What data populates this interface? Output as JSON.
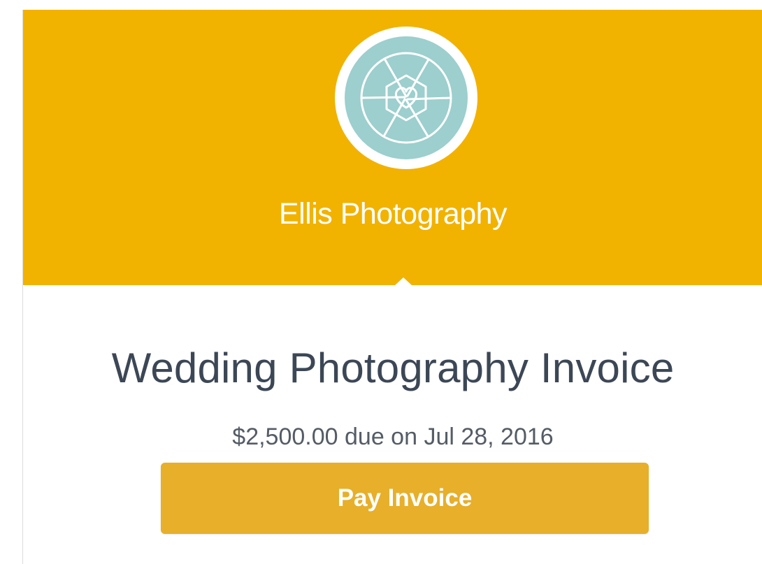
{
  "business": {
    "name": "Ellis Photography",
    "logo_icon": "camera-aperture-heart-icon"
  },
  "invoice": {
    "title": "Wedding Photography Invoice",
    "due_text": "$2,500.00 due on Jul 28, 2016",
    "amount": "$2,500.00",
    "due_date": "Jul 28, 2016"
  },
  "actions": {
    "pay_label": "Pay Invoice"
  },
  "colors": {
    "header_bg": "#f2b200",
    "button_bg": "#e7af2a",
    "logo_bg": "#9ccfce",
    "title_text": "#3c4756"
  }
}
